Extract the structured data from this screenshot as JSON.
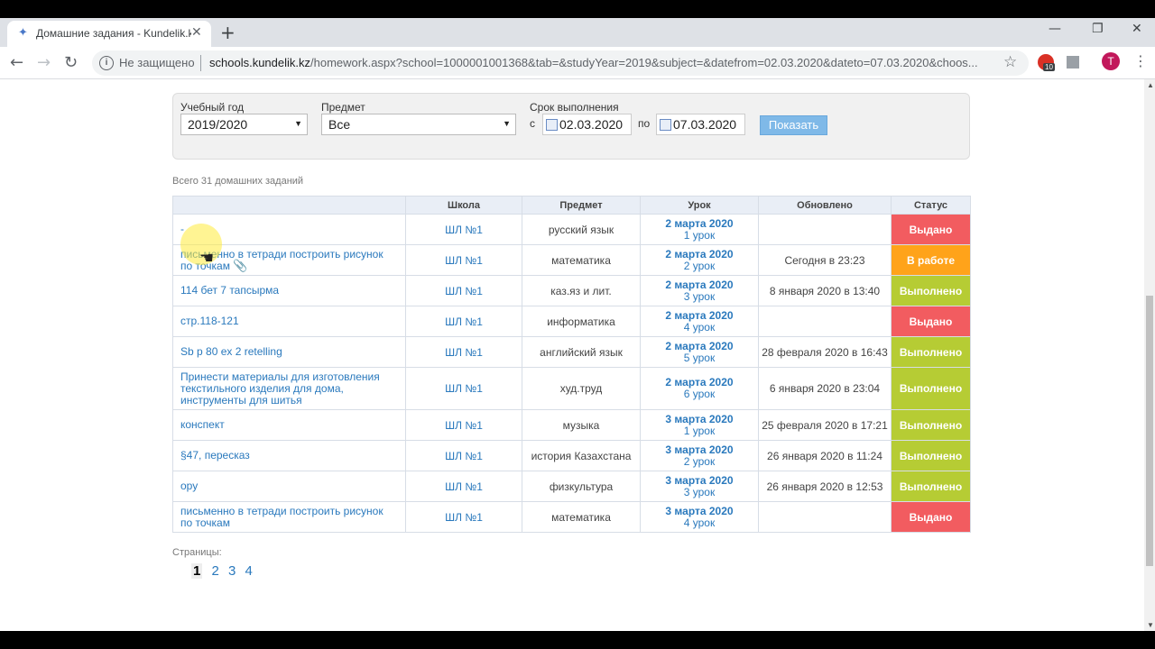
{
  "browser": {
    "tab_title": "Домашние задания - Kundelik.kz",
    "security_label": "Не защищено",
    "url_host": "schools.kundelik.kz",
    "url_rest": "/homework.aspx?school=1000001001368&tab=&studyYear=2019&subject=&datefrom=02.03.2020&dateto=07.03.2020&choos...",
    "extension_badge": "10",
    "avatar_letter": "T"
  },
  "filter": {
    "year_label": "Учебный год",
    "year_value": "2019/2020",
    "subject_label": "Предмет",
    "subject_value": "Все",
    "deadline_label": "Срок выполнения",
    "from_label": "с",
    "from_value": "02.03.2020",
    "to_label": "по",
    "to_value": "07.03.2020",
    "show_button": "Показать"
  },
  "total": "Всего 31 домашних заданий",
  "table": {
    "headers": [
      "",
      "Школа",
      "Предмет",
      "Урок",
      "Обновлено",
      "Статус"
    ],
    "rows": [
      {
        "title": "-",
        "school": "ШЛ №1",
        "subject": "русский язык",
        "date": "2 марта 2020",
        "lesson": "1 урок",
        "updated": "",
        "status": "Выдано",
        "status_color": "#f25c60"
      },
      {
        "title": "письменно в тетради построить рисунок по точкам",
        "school": "ШЛ №1",
        "subject": "математика",
        "date": "2 марта 2020",
        "lesson": "2 урок",
        "updated": "Сегодня в 23:23",
        "status": "В работе",
        "status_color": "#ffa31a"
      },
      {
        "title": "114 бет 7 тапсырма",
        "school": "ШЛ №1",
        "subject": "каз.яз и лит.",
        "date": "2 марта 2020",
        "lesson": "3 урок",
        "updated": "8 января 2020 в 13:40",
        "status": "Выполнено",
        "status_color": "#b6cc34"
      },
      {
        "title": "стр.118-121",
        "school": "ШЛ №1",
        "subject": "информатика",
        "date": "2 марта 2020",
        "lesson": "4 урок",
        "updated": "",
        "status": "Выдано",
        "status_color": "#f25c60"
      },
      {
        "title": "Sb p 80 ex 2 retelling",
        "school": "ШЛ №1",
        "subject": "английский язык",
        "date": "2 марта 2020",
        "lesson": "5 урок",
        "updated": "28 февраля 2020 в 16:43",
        "status": "Выполнено",
        "status_color": "#b6cc34"
      },
      {
        "title": "Принести материалы для изготовления текстильного изделия для дома, инструменты для шитья",
        "school": "ШЛ №1",
        "subject": "худ.труд",
        "date": "2 марта 2020",
        "lesson": "6 урок",
        "updated": "6 января 2020 в 23:04",
        "status": "Выполнено",
        "status_color": "#b6cc34"
      },
      {
        "title": "конспект",
        "school": "ШЛ №1",
        "subject": "музыка",
        "date": "3 марта 2020",
        "lesson": "1 урок",
        "updated": "25 февраля 2020 в 17:21",
        "status": "Выполнено",
        "status_color": "#b6cc34"
      },
      {
        "title": "§47, пересказ",
        "school": "ШЛ №1",
        "subject": "история Казахстана",
        "date": "3 марта 2020",
        "lesson": "2 урок",
        "updated": "26 января 2020 в 11:24",
        "status": "Выполнено",
        "status_color": "#b6cc34"
      },
      {
        "title": "ору",
        "school": "ШЛ №1",
        "subject": "физкультура",
        "date": "3 марта 2020",
        "lesson": "3 урок",
        "updated": "26 января 2020 в 12:53",
        "status": "Выполнено",
        "status_color": "#b6cc34"
      },
      {
        "title": "письменно в тетради построить рисунок по точкам",
        "school": "ШЛ №1",
        "subject": "математика",
        "date": "3 марта 2020",
        "lesson": "4 урок",
        "updated": "",
        "status": "Выдано",
        "status_color": "#f25c60"
      }
    ]
  },
  "pagination": {
    "label": "Страницы:",
    "pages": [
      "1",
      "2",
      "3",
      "4"
    ],
    "current": "1"
  }
}
